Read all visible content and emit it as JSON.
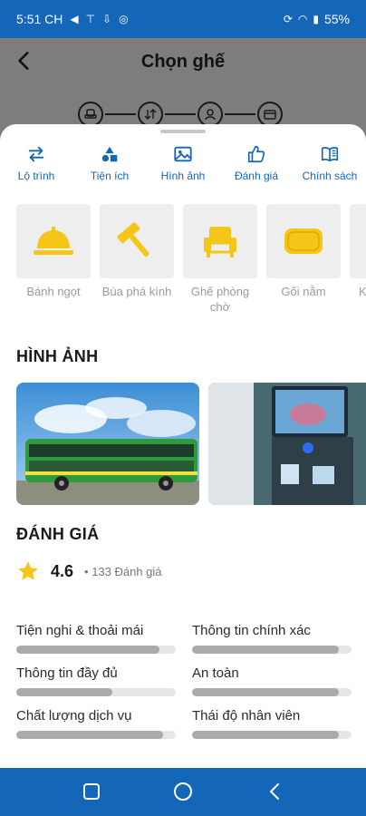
{
  "status_bar": {
    "time": "5:51 CH",
    "battery": "55%"
  },
  "header": {
    "title": "Chọn ghế"
  },
  "tabs": [
    {
      "label": "Lộ trình",
      "icon": "swap-icon"
    },
    {
      "label": "Tiện ích",
      "icon": "shapes-icon"
    },
    {
      "label": "Hình ảnh",
      "icon": "image-icon"
    },
    {
      "label": "Đánh giá",
      "icon": "thumbs-up-icon"
    },
    {
      "label": "Chính sách",
      "icon": "book-icon"
    }
  ],
  "amenities": [
    {
      "label": "Bánh ngọt",
      "icon": "cloche-icon"
    },
    {
      "label": "Búa phá kính",
      "icon": "hammer-icon"
    },
    {
      "label": "Ghế phòng chờ",
      "icon": "armchair-icon"
    },
    {
      "label": "Gối nằm",
      "icon": "pillow-icon"
    },
    {
      "label": "K",
      "icon": "amenity-icon"
    }
  ],
  "images_section": {
    "title": "HÌNH ẢNH"
  },
  "reviews": {
    "title": "ĐÁNH GIÁ",
    "score": "4.6",
    "count": "• 133 Đánh giá",
    "criteria": [
      {
        "label": "Tiện nghi & thoải mái",
        "level": 0.9
      },
      {
        "label": "Thông tin chính xác",
        "level": 0.92
      },
      {
        "label": "Thông tin đầy đủ",
        "level": 0.6
      },
      {
        "label": "An toàn",
        "level": 0.92
      },
      {
        "label": "Chất lượng dịch vụ",
        "level": 0.92
      },
      {
        "label": "Thái độ nhân viên",
        "level": 0.92
      }
    ]
  },
  "colors": {
    "brand": "#1366b8",
    "accent": "#f5c518",
    "tile": "#eeeeee"
  }
}
